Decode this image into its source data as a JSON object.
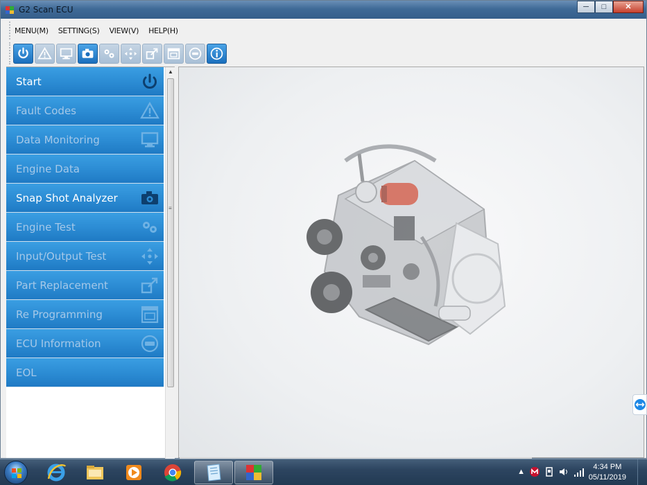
{
  "window": {
    "title": "G2 Scan ECU",
    "controls": {
      "minimize": "─",
      "maximize": "□",
      "close": "✕"
    }
  },
  "menu": {
    "items": [
      "MENU(M)",
      "SETTING(S)",
      "VIEW(V)",
      "HELP(H)"
    ]
  },
  "toolbar": {
    "buttons": [
      {
        "icon": "power-icon",
        "state": "active"
      },
      {
        "icon": "warning-icon",
        "state": "dim"
      },
      {
        "icon": "monitor-icon",
        "state": "dim"
      },
      {
        "icon": "camera-icon",
        "state": "active"
      },
      {
        "icon": "gears-icon",
        "state": "dim"
      },
      {
        "icon": "arrows-icon",
        "state": "dim"
      },
      {
        "icon": "replace-icon",
        "state": "dim"
      },
      {
        "icon": "reprogram-icon",
        "state": "dim"
      },
      {
        "icon": "ecu-icon",
        "state": "dim"
      },
      {
        "icon": "info-icon",
        "state": "active"
      }
    ]
  },
  "sidebar": {
    "items": [
      {
        "label": "Start",
        "icon": "power-icon",
        "enabled": true
      },
      {
        "label": "Fault Codes",
        "icon": "warning-icon",
        "enabled": false
      },
      {
        "label": "Data Monitoring",
        "icon": "monitor-icon",
        "enabled": false
      },
      {
        "label": "Engine Data",
        "icon": "none",
        "enabled": false
      },
      {
        "label": "Snap Shot Analyzer",
        "icon": "camera-icon",
        "enabled": true
      },
      {
        "label": "Engine Test",
        "icon": "gears-icon",
        "enabled": false
      },
      {
        "label": "Input/Output Test",
        "icon": "arrows-icon",
        "enabled": false
      },
      {
        "label": "Part Replacement",
        "icon": "replace-icon",
        "enabled": false
      },
      {
        "label": "Re Programming",
        "icon": "reprogram-icon",
        "enabled": false
      },
      {
        "label": "ECU Information",
        "icon": "ecu-icon",
        "enabled": false
      },
      {
        "label": "EOL",
        "icon": "none",
        "enabled": false
      }
    ]
  },
  "taskbar": {
    "apps": [
      "internet-explorer-icon",
      "file-explorer-icon",
      "media-player-icon",
      "chrome-icon",
      "notepad-icon",
      "g2-scan-icon"
    ],
    "clock": {
      "time": "4:34 PM",
      "date": "05/11/2019"
    },
    "tray_arrow": "▲"
  },
  "colors": {
    "accent": "#2b8bd3",
    "title_bar": "#3f6a97"
  }
}
